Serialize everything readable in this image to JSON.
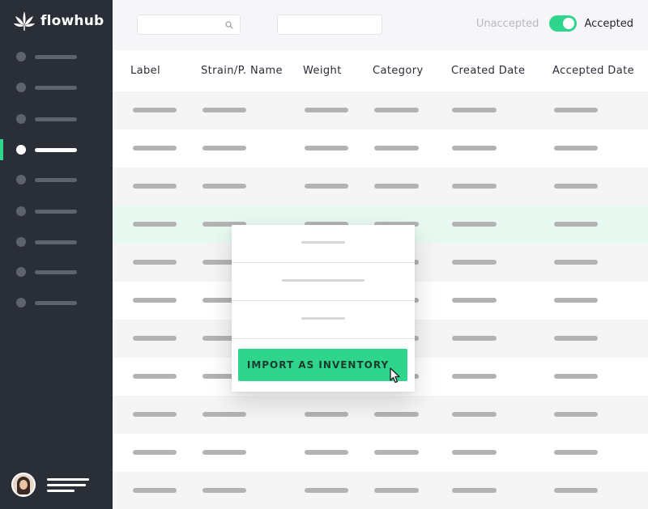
{
  "app": {
    "brand": "flowhub"
  },
  "sidebar": {
    "items": [
      {
        "active": false
      },
      {
        "active": false
      },
      {
        "active": false
      },
      {
        "active": true
      },
      {
        "active": false
      },
      {
        "active": false
      },
      {
        "active": false
      },
      {
        "active": false
      },
      {
        "active": false
      }
    ]
  },
  "toggle": {
    "off_label": "Unaccepted",
    "on_label": "Accepted",
    "state": "Accepted"
  },
  "table": {
    "columns": [
      "Label",
      "Strain/P. Name",
      "Weight",
      "Category",
      "Created Date",
      "Accepted Date"
    ],
    "row_count": 11,
    "highlighted_row": 3
  },
  "popup": {
    "import_label": "IMPORT AS INVENTORY"
  },
  "colors": {
    "accent": "#2fd58c",
    "sidebar": "#2a2e37",
    "highlight_row": "#e8f9f1"
  }
}
